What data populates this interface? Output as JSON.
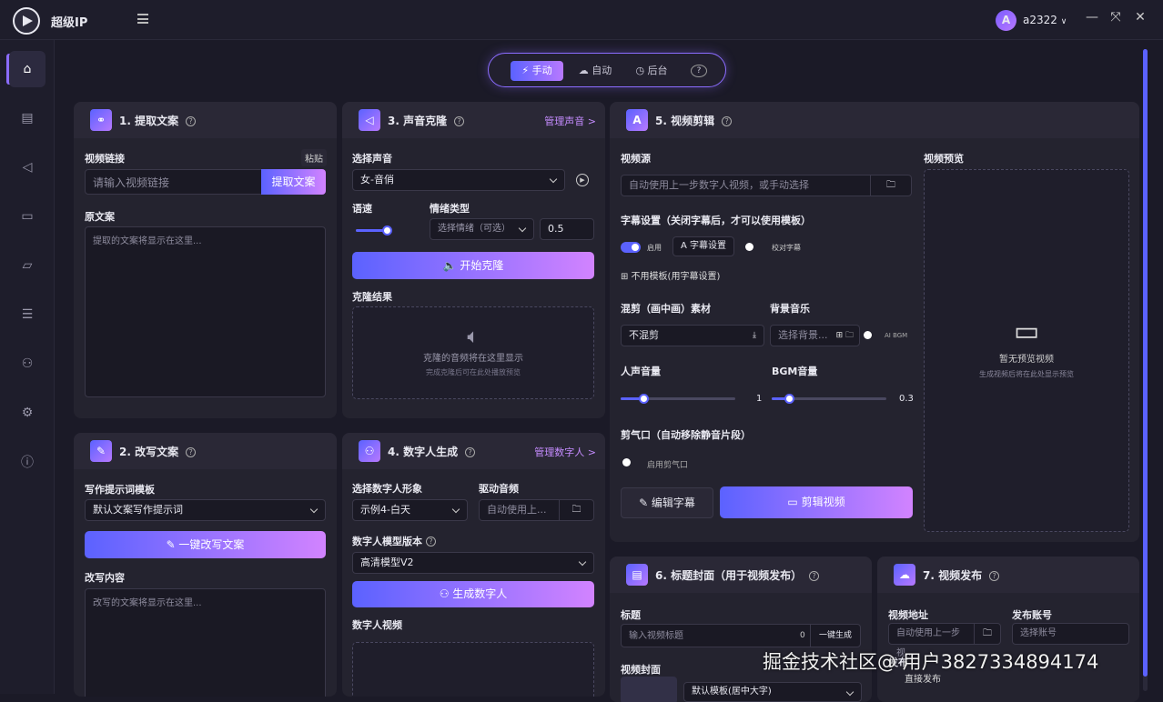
{
  "app": {
    "title": "超级IP",
    "username": "a2322",
    "avatar_letter": "A"
  },
  "window": {
    "minimize": "—",
    "maximize": "⤧",
    "close": "✕"
  },
  "sidebar": [
    "home-icon",
    "file-icon",
    "sound-icon",
    "video-icon",
    "folder-icon",
    "list-icon",
    "user-icon",
    "settings-icon",
    "help-icon"
  ],
  "modes": {
    "manual": "⚡ 手动",
    "auto": "☁ 自动",
    "background": "◷ 后台",
    "help": "?"
  },
  "p1": {
    "title": "1. 提取文案",
    "link_label": "视频链接",
    "paste": "粘贴",
    "link_placeholder": "请输入视频链接",
    "extract_btn": "提取文案",
    "orig_label": "原文案",
    "orig_placeholder": "提取的文案将显示在这里..."
  },
  "p2": {
    "title": "2. 改写文案",
    "tpl_label": "写作提示词模板",
    "tpl_value": "默认文案写作提示词",
    "rewrite_btn": "✎ 一键改写文案",
    "content_label": "改写内容",
    "content_placeholder": "改写的文案将显示在这里..."
  },
  "p3": {
    "title": "3. 声音克隆",
    "manage": "管理声音 >",
    "voice_label": "选择声音",
    "voice_value": "女-音俏",
    "speed_label": "语速",
    "emotion_label": "情绪类型",
    "emotion_value": "选择情绪（可选）",
    "emotion_num": "0.5",
    "clone_btn": "🔈 开始克隆",
    "result_label": "克隆结果",
    "result_text": "克隆的音频将在这里显示",
    "result_sub": "完成克隆后可在此处播放预览",
    "speed_value": 0.3
  },
  "p4": {
    "title": "4. 数字人生成",
    "manage": "管理数字人 >",
    "avatar_label": "选择数字人形象",
    "avatar_value": "示例4-白天",
    "audio_label": "驱动音频",
    "audio_value": "自动使用上...",
    "model_label": "数字人模型版本",
    "model_value": "高清模型V2",
    "gen_btn": "⚇ 生成数字人",
    "video_label": "数字人视频"
  },
  "p5": {
    "title": "5. 视频剪辑",
    "src_label": "视频源",
    "src_value": "自动使用上一步数字人视频，或手动选择",
    "sub_label": "字幕设置（关闭字幕后，才可以使用模板）",
    "enable": "启用",
    "sub_settings": "A 字幕设置",
    "proofread": "校对字幕",
    "no_template": "⊞ 不用模板(用字幕设置)",
    "mix_label": "混剪（画中画）素材",
    "mix_value": "不混剪",
    "bgm_label": "背景音乐",
    "bgm_value": "选择背景...",
    "ai_bgm": "AI BGM",
    "voice_vol_label": "人声音量",
    "voice_vol": "1",
    "bgm_vol_label": "BGM音量",
    "bgm_vol": "0.3",
    "cut_label": "剪气口（自动移除静音片段）",
    "cut_enable": "启用剪气口",
    "edit_sub_btn": "✎ 编辑字幕",
    "cut_btn": "剪辑视频",
    "preview_label": "视频预览",
    "no_preview": "暂无预览视频",
    "preview_sub": "生成视频后将在此处显示预览",
    "voice_vol_fraction": 0.2,
    "bgm_vol_fraction": 0.15
  },
  "p6": {
    "title": "6. 标题封面（用于视频发布）",
    "title_label": "标题",
    "title_placeholder": "输入视频标题",
    "count": "0",
    "one_click": "一键生成",
    "cover_label": "视频封面",
    "cover_tpl": "默认模板(居中大字)"
  },
  "p7": {
    "title": "7. 视频发布",
    "addr_label": "视频地址",
    "addr_value": "自动使用上一步视...",
    "account_label": "发布账号",
    "account_value": "选择账号",
    "publish_label": "发布",
    "direct": "直接发布"
  },
  "watermark": "掘金技术社区@ 用户3827334894174"
}
